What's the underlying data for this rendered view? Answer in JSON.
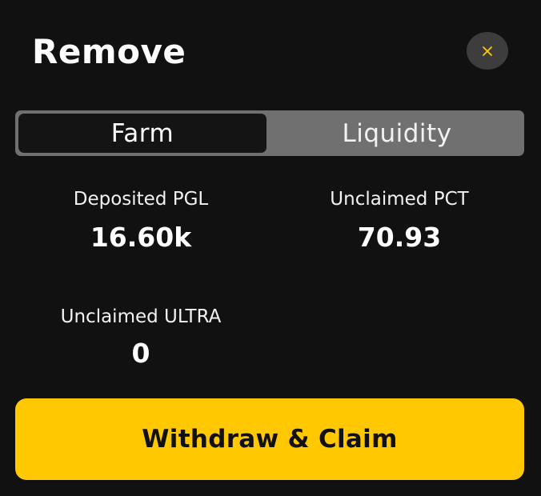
{
  "modal": {
    "title": "Remove",
    "close_icon": "close-icon",
    "accent_color": "#ffc800"
  },
  "tabs": [
    {
      "label": "Farm",
      "active": true
    },
    {
      "label": "Liquidity",
      "active": false
    }
  ],
  "stats": {
    "deposited_pgl": {
      "label": "Deposited PGL",
      "value": "16.60k"
    },
    "unclaimed_pct": {
      "label": "Unclaimed PCT",
      "value": "70.93"
    },
    "unclaimed_ultra": {
      "label": "Unclaimed ULTRA",
      "value": "0"
    }
  },
  "action": {
    "label": "Withdraw & Claim"
  }
}
